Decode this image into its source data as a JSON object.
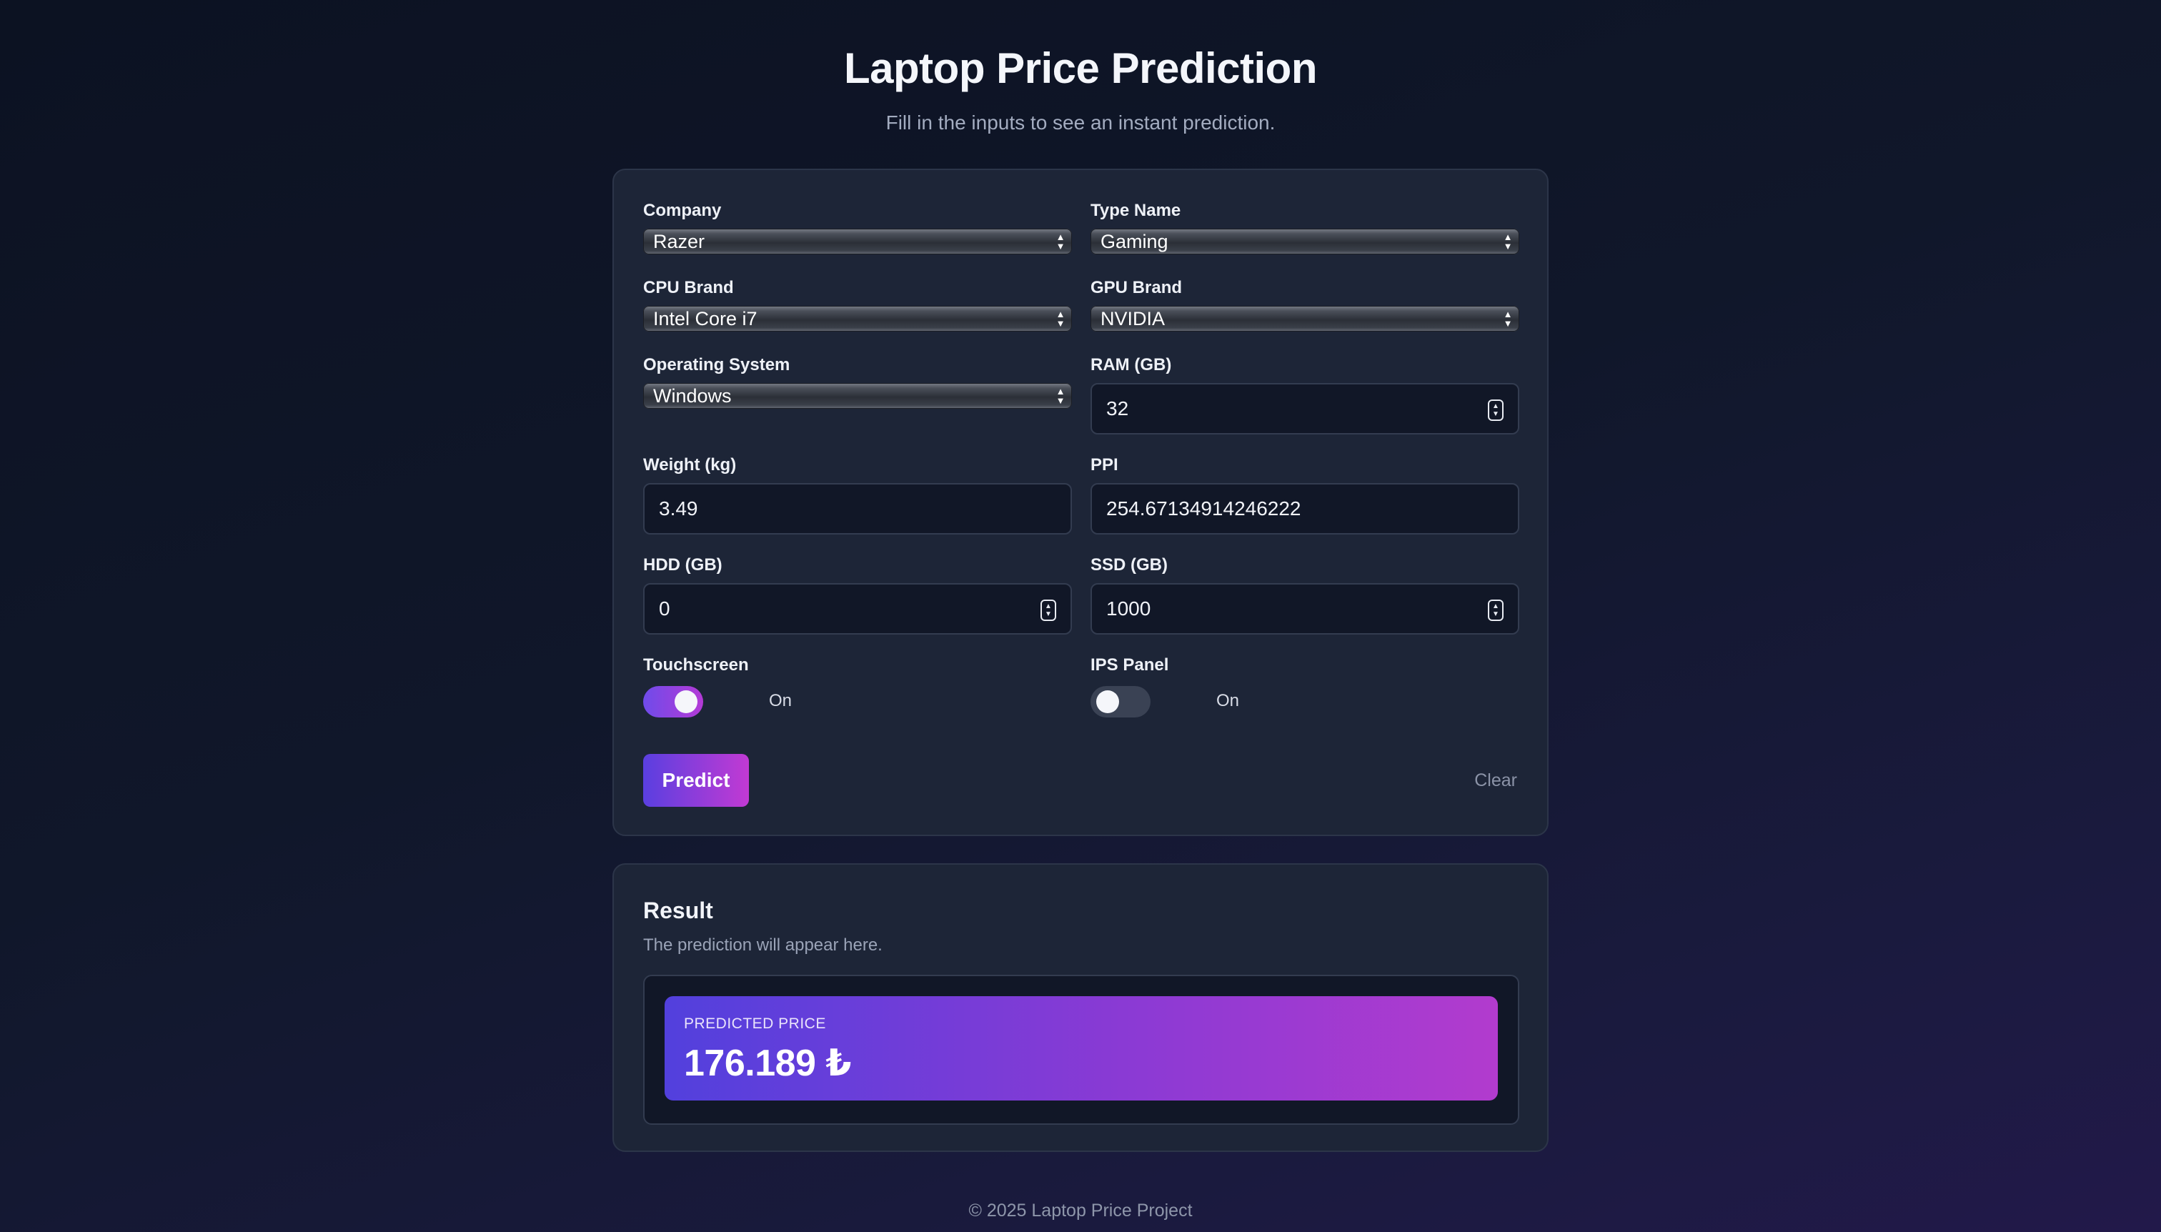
{
  "header": {
    "title": "Laptop Price Prediction",
    "subtitle": "Fill in the inputs to see an instant prediction."
  },
  "form": {
    "company": {
      "label": "Company",
      "value": "Razer"
    },
    "type_name": {
      "label": "Type Name",
      "value": "Gaming"
    },
    "cpu_brand": {
      "label": "CPU Brand",
      "value": "Intel Core i7"
    },
    "gpu_brand": {
      "label": "GPU Brand",
      "value": "NVIDIA"
    },
    "os": {
      "label": "Operating System",
      "value": "Windows"
    },
    "ram": {
      "label": "RAM (GB)",
      "value": "32"
    },
    "weight": {
      "label": "Weight (kg)",
      "value": "3.49"
    },
    "ppi": {
      "label": "PPI",
      "value": "254.67134914246222"
    },
    "hdd": {
      "label": "HDD (GB)",
      "value": "0"
    },
    "ssd": {
      "label": "SSD (GB)",
      "value": "1000"
    },
    "touchscreen": {
      "label": "Touchscreen",
      "state_text": "On",
      "checked": true
    },
    "ips": {
      "label": "IPS Panel",
      "state_text": "On",
      "checked": false
    },
    "predict_label": "Predict",
    "clear_label": "Clear"
  },
  "result": {
    "title": "Result",
    "description": "The prediction will appear here.",
    "price_label": "PREDICTED PRICE",
    "price_value": "176.189 ₺"
  },
  "footer": {
    "text": "© 2025 Laptop Price Project"
  },
  "colors": {
    "background": "#0f1528",
    "card": "#1d2537",
    "accent_start": "#5a3fe0",
    "accent_end": "#c23ad3"
  }
}
